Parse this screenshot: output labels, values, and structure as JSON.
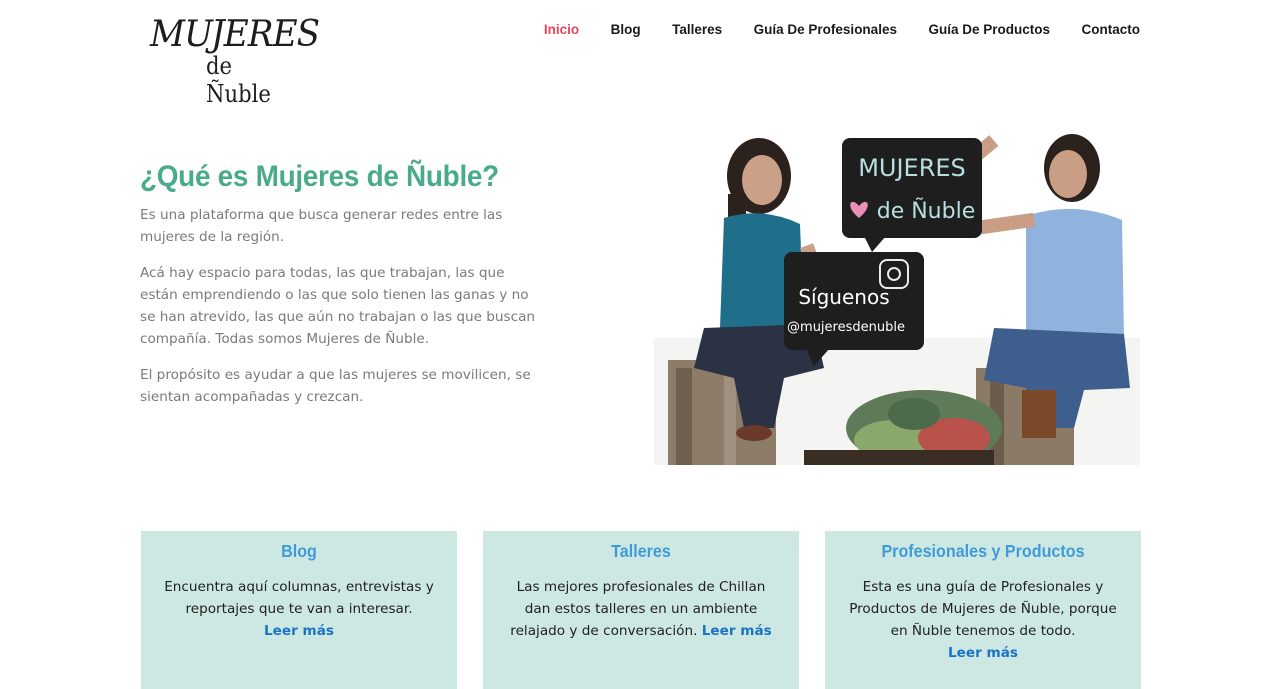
{
  "header": {
    "logo_main": "MUJERES",
    "logo_sub": "de Ñuble",
    "nav": [
      {
        "label": "Inicio",
        "active": true
      },
      {
        "label": "Blog",
        "active": false
      },
      {
        "label": "Talleres",
        "active": false
      },
      {
        "label": "Guía De Profesionales",
        "active": false
      },
      {
        "label": "Guía De Productos",
        "active": false
      },
      {
        "label": "Contacto",
        "active": false
      }
    ]
  },
  "intro": {
    "title": "¿Qué es Mujeres de Ñuble?",
    "paragraphs": [
      "Es una plataforma que busca generar redes entre las mujeres de la región.",
      "Acá hay espacio para todas, las que trabajan, las que están emprendiendo o las que solo tienen las ganas y no se han atrevido, las que aún no trabajan o las que buscan compañía. Todas somos Mujeres de Ñuble.",
      "El propósito es ayudar a que las mujeres se movilicen, se sientan acompañadas y crezcan."
    ]
  },
  "photo": {
    "sign1_line1": "MUJERES",
    "sign1_line2": "de Ñuble",
    "sign2_line1": "Síguenos",
    "sign2_line2": "@mujeresdenuble"
  },
  "cards": [
    {
      "title": "Blog",
      "text": "Encuentra aquí columnas, entrevistas y reportajes que te van a interesar.",
      "more": "Leer más"
    },
    {
      "title": "Talleres",
      "text": "Las mejores profesionales de Chillan dan estos talleres en un ambiente relajado y de conversación.",
      "more": "Leer más"
    },
    {
      "title": "Profesionales y Productos",
      "text": "Esta es una guía de Profesionales y Productos de Mujeres de Ñuble, porque en Ñuble tenemos de todo.",
      "more": "Leer más"
    }
  ],
  "colors": {
    "accent_green": "#4aab8c",
    "nav_active": "#e2465b",
    "card_bg": "#cde8e2",
    "card_title": "#3f9bd8",
    "link": "#1a73c4"
  }
}
